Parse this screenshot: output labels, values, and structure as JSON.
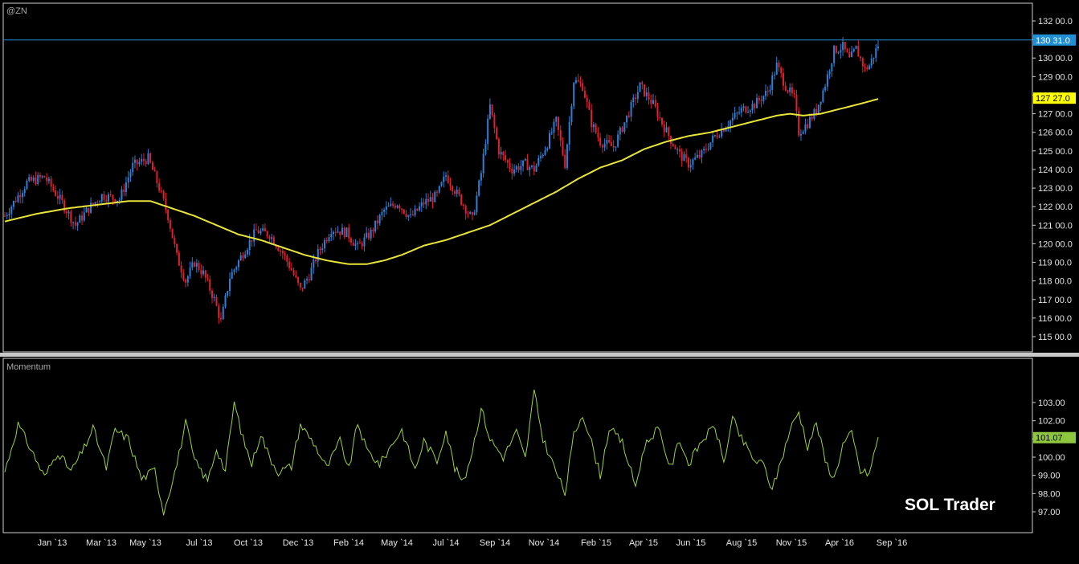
{
  "chart_data": [
    {
      "type": "candlestick",
      "symbol": "@ZN",
      "y_ticks": [
        "132 00.0",
        "131 00.0",
        "130 00.0",
        "129 00.0",
        "128 00.0",
        "127 00.0",
        "126 00.0",
        "125 00.0",
        "124 00.0",
        "123 00.0",
        "122 00.0",
        "121 00.0",
        "120 00.0",
        "119 00.0",
        "118 00.0",
        "117 00.0",
        "116 00.0",
        "115 00.0"
      ],
      "ylim": [
        114.4,
        132.6
      ],
      "last_price": {
        "label": "130 31.0",
        "value": 130.97,
        "color": "#1f8fd6"
      },
      "ma_marker": {
        "label": "127 27.0",
        "value": 127.84,
        "color": "#ffff00"
      },
      "up_color": "#2f7fd6",
      "down_color": "#e02030",
      "ma_color": "#e8e43a",
      "approx_close_path": [
        [
          0,
          121.5
        ],
        [
          10,
          123.3
        ],
        [
          18,
          123.6
        ],
        [
          26,
          122.2
        ],
        [
          32,
          121.0
        ],
        [
          38,
          121.9
        ],
        [
          44,
          122.6
        ],
        [
          52,
          122.4
        ],
        [
          58,
          124.2
        ],
        [
          65,
          124.6
        ],
        [
          70,
          123.0
        ],
        [
          74,
          121.5
        ],
        [
          78,
          119.3
        ],
        [
          82,
          118.0
        ],
        [
          86,
          119.0
        ],
        [
          90,
          118.4
        ],
        [
          95,
          117.0
        ],
        [
          98,
          115.8
        ],
        [
          102,
          118.2
        ],
        [
          108,
          119.5
        ],
        [
          114,
          120.7
        ],
        [
          120,
          120.5
        ],
        [
          126,
          119.5
        ],
        [
          130,
          118.6
        ],
        [
          134,
          117.5
        ],
        [
          138,
          118.3
        ],
        [
          142,
          119.5
        ],
        [
          148,
          120.8
        ],
        [
          155,
          120.6
        ],
        [
          160,
          119.8
        ],
        [
          166,
          120.6
        ],
        [
          172,
          121.8
        ],
        [
          178,
          122.2
        ],
        [
          184,
          121.4
        ],
        [
          190,
          122.2
        ],
        [
          196,
          122.6
        ],
        [
          200,
          123.7
        ],
        [
          206,
          122.5
        ],
        [
          212,
          121.3
        ],
        [
          216,
          123.8
        ],
        [
          220,
          127.4
        ],
        [
          224,
          125.0
        ],
        [
          230,
          124.0
        ],
        [
          236,
          124.3
        ],
        [
          240,
          124.0
        ],
        [
          246,
          125.4
        ],
        [
          250,
          126.6
        ],
        [
          254,
          124.3
        ],
        [
          258,
          128.8
        ],
        [
          262,
          128.5
        ],
        [
          266,
          126.5
        ],
        [
          270,
          125.5
        ],
        [
          276,
          125.2
        ],
        [
          282,
          126.8
        ],
        [
          288,
          128.5
        ],
        [
          294,
          127.5
        ],
        [
          298,
          126.5
        ],
        [
          302,
          125.6
        ],
        [
          306,
          124.8
        ],
        [
          310,
          124.3
        ],
        [
          316,
          124.8
        ],
        [
          322,
          125.8
        ],
        [
          328,
          126.5
        ],
        [
          334,
          127.2
        ],
        [
          340,
          127.5
        ],
        [
          346,
          128.2
        ],
        [
          350,
          129.6
        ],
        [
          354,
          128.5
        ],
        [
          358,
          127.8
        ],
        [
          360,
          126.0
        ],
        [
          364,
          126.5
        ],
        [
          368,
          127.2
        ],
        [
          372,
          128.6
        ],
        [
          376,
          130.4
        ],
        [
          380,
          130.6
        ],
        [
          383,
          129.9
        ],
        [
          386,
          130.5
        ],
        [
          390,
          129.4
        ],
        [
          392,
          129.6
        ],
        [
          396,
          130.7
        ]
      ],
      "approx_ma_path": [
        [
          0,
          121.2
        ],
        [
          14,
          121.6
        ],
        [
          28,
          121.9
        ],
        [
          42,
          122.1
        ],
        [
          56,
          122.3
        ],
        [
          66,
          122.3
        ],
        [
          76,
          121.9
        ],
        [
          86,
          121.5
        ],
        [
          96,
          121.0
        ],
        [
          106,
          120.5
        ],
        [
          116,
          120.2
        ],
        [
          126,
          119.8
        ],
        [
          136,
          119.4
        ],
        [
          146,
          119.1
        ],
        [
          156,
          118.9
        ],
        [
          164,
          118.9
        ],
        [
          172,
          119.1
        ],
        [
          180,
          119.4
        ],
        [
          190,
          119.9
        ],
        [
          200,
          120.2
        ],
        [
          210,
          120.6
        ],
        [
          220,
          121.0
        ],
        [
          230,
          121.6
        ],
        [
          240,
          122.2
        ],
        [
          250,
          122.8
        ],
        [
          260,
          123.5
        ],
        [
          270,
          124.1
        ],
        [
          280,
          124.5
        ],
        [
          290,
          125.1
        ],
        [
          300,
          125.5
        ],
        [
          310,
          125.8
        ],
        [
          320,
          126.0
        ],
        [
          330,
          126.3
        ],
        [
          340,
          126.6
        ],
        [
          350,
          126.9
        ],
        [
          356,
          127.0
        ],
        [
          362,
          126.9
        ],
        [
          370,
          127.0
        ],
        [
          380,
          127.3
        ],
        [
          390,
          127.6
        ],
        [
          396,
          127.8
        ]
      ]
    },
    {
      "type": "line",
      "title": "Momentum",
      "y_ticks": [
        "103.00",
        "102.00",
        "101.00",
        "100.00",
        "99.00",
        "98.00",
        "97.00"
      ],
      "ylim": [
        96.3,
        103.9
      ],
      "last_value": {
        "label": "101.07",
        "value": 101.07,
        "color": "#8ec63f"
      },
      "line_color": "#9fd040",
      "approx_path": [
        [
          0,
          99.2
        ],
        [
          6,
          101.8
        ],
        [
          12,
          100.4
        ],
        [
          18,
          98.9
        ],
        [
          24,
          100.3
        ],
        [
          30,
          99.2
        ],
        [
          36,
          100.5
        ],
        [
          40,
          101.6
        ],
        [
          46,
          99.4
        ],
        [
          50,
          101.5
        ],
        [
          56,
          101.0
        ],
        [
          62,
          98.8
        ],
        [
          68,
          99.3
        ],
        [
          72,
          97.0
        ],
        [
          78,
          99.6
        ],
        [
          82,
          101.9
        ],
        [
          86,
          99.8
        ],
        [
          92,
          98.7
        ],
        [
          96,
          100.5
        ],
        [
          100,
          99.2
        ],
        [
          104,
          103.0
        ],
        [
          108,
          101.0
        ],
        [
          112,
          99.6
        ],
        [
          116,
          101.3
        ],
        [
          120,
          100.0
        ],
        [
          124,
          99.2
        ],
        [
          130,
          99.5
        ],
        [
          134,
          101.8
        ],
        [
          140,
          100.8
        ],
        [
          146,
          99.4
        ],
        [
          152,
          100.9
        ],
        [
          156,
          99.3
        ],
        [
          160,
          101.9
        ],
        [
          164,
          100.4
        ],
        [
          170,
          99.6
        ],
        [
          176,
          100.8
        ],
        [
          180,
          101.5
        ],
        [
          186,
          99.3
        ],
        [
          190,
          100.9
        ],
        [
          196,
          99.8
        ],
        [
          200,
          101.5
        ],
        [
          204,
          99.4
        ],
        [
          208,
          98.6
        ],
        [
          212,
          100.4
        ],
        [
          216,
          102.7
        ],
        [
          220,
          101.0
        ],
        [
          226,
          100.0
        ],
        [
          232,
          101.4
        ],
        [
          236,
          99.9
        ],
        [
          240,
          103.6
        ],
        [
          244,
          101.0
        ],
        [
          248,
          99.8
        ],
        [
          254,
          98.0
        ],
        [
          258,
          101.2
        ],
        [
          262,
          102.4
        ],
        [
          266,
          100.8
        ],
        [
          270,
          99.0
        ],
        [
          274,
          101.6
        ],
        [
          280,
          100.8
        ],
        [
          286,
          98.4
        ],
        [
          290,
          100.6
        ],
        [
          296,
          101.6
        ],
        [
          302,
          99.4
        ],
        [
          306,
          101.0
        ],
        [
          310,
          99.6
        ],
        [
          316,
          100.9
        ],
        [
          322,
          101.7
        ],
        [
          326,
          99.7
        ],
        [
          330,
          102.1
        ],
        [
          334,
          101.0
        ],
        [
          340,
          99.8
        ],
        [
          344,
          99.6
        ],
        [
          348,
          98.2
        ],
        [
          352,
          99.8
        ],
        [
          356,
          101.5
        ],
        [
          360,
          102.5
        ],
        [
          364,
          100.6
        ],
        [
          368,
          101.9
        ],
        [
          372,
          99.8
        ],
        [
          376,
          98.8
        ],
        [
          380,
          100.7
        ],
        [
          384,
          101.3
        ],
        [
          388,
          99.2
        ],
        [
          392,
          99.1
        ],
        [
          396,
          101.1
        ]
      ]
    }
  ],
  "x_axis": {
    "labels": [
      "Jan `13",
      "Mar `13",
      "May `13",
      "Jul `13",
      "Oct `13",
      "Dec `13",
      "Feb `14",
      "May `14",
      "Jul `14",
      "Sep `14",
      "Nov `14",
      "Feb `15",
      "Apr `15",
      "Jun `15",
      "Aug `15",
      "Nov `15",
      "Apr `16",
      "Sep `16"
    ],
    "label_index": [
      14,
      42,
      70,
      98,
      126,
      154,
      182,
      210,
      238,
      266,
      294,
      322,
      350,
      378,
      406,
      434,
      462,
      490
    ]
  },
  "watermark": "SOL Trader",
  "colors": {
    "background": "#000000",
    "frame": "#d0d0d0",
    "divider": "#c8c8c8",
    "axis_text": "#e6e6e6",
    "label_text": "#a8a8a8"
  }
}
